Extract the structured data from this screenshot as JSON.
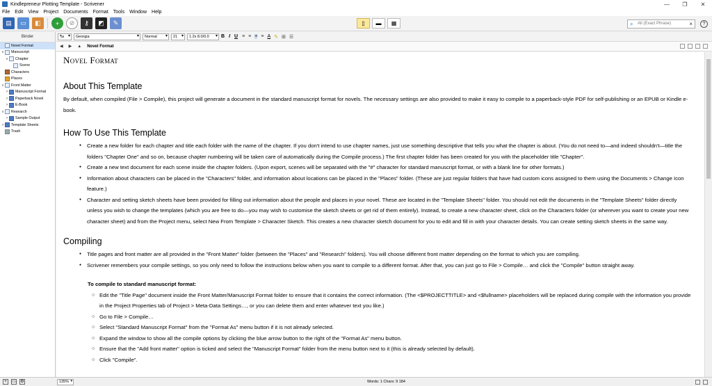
{
  "window": {
    "title": "Kindlepreneur Plotting Template - Scrivener",
    "minimize": "—",
    "restore": "❐",
    "close": "✕"
  },
  "menu": [
    "File",
    "Edit",
    "View",
    "Project",
    "Documents",
    "Format",
    "Tools",
    "Window",
    "Help"
  ],
  "search": {
    "placeholder": "All (Exact Phrase)"
  },
  "binder": {
    "header": "Binder",
    "items": [
      {
        "label": "Novel Format",
        "indent": 0,
        "arrow": "",
        "icon": "doc",
        "selected": true
      },
      {
        "label": "Manuscript",
        "indent": 0,
        "arrow": "∨",
        "icon": "doc"
      },
      {
        "label": "Chapter",
        "indent": 1,
        "arrow": "∨",
        "icon": "doc"
      },
      {
        "label": "Scene",
        "indent": 2,
        "arrow": "",
        "icon": "doc"
      },
      {
        "label": "Characters",
        "indent": 0,
        "arrow": "",
        "icon": "chars"
      },
      {
        "label": "Places",
        "indent": 0,
        "arrow": "",
        "icon": "places"
      },
      {
        "label": "Front Matter",
        "indent": 0,
        "arrow": "∨",
        "icon": "doc"
      },
      {
        "label": "Manuscript Format",
        "indent": 1,
        "arrow": ">",
        "icon": "folder"
      },
      {
        "label": "Paperback Novel",
        "indent": 1,
        "arrow": ">",
        "icon": "folder"
      },
      {
        "label": "E-Book",
        "indent": 1,
        "arrow": ">",
        "icon": "folder"
      },
      {
        "label": "Research",
        "indent": 0,
        "arrow": "∨",
        "icon": "doc"
      },
      {
        "label": "Sample Output",
        "indent": 1,
        "arrow": ">",
        "icon": "folder"
      },
      {
        "label": "Template Sheets",
        "indent": 0,
        "arrow": ">",
        "icon": "folder"
      },
      {
        "label": "Trash",
        "indent": 0,
        "arrow": "",
        "icon": "trash"
      }
    ]
  },
  "format": {
    "style": "¶a",
    "font": "Georgia",
    "weight": "Normal",
    "size": "21",
    "spacing": "1.2x 8.0/0.0",
    "bold": "B",
    "italic": "I",
    "underline": "U"
  },
  "header": {
    "back": "◀",
    "forward": "▶",
    "doc_title": "Novel Format"
  },
  "doc": {
    "heading": "Novel Format",
    "about_title": "About This Template",
    "about_body": "By default, when compiled (File > Compile), this project will generate a document in the standard manuscript format for novels. The necessary settings are also provided to make it easy to compile to a paperback-style PDF for self-publishing or an EPUB or Kindle e-book.",
    "howto_title": "How To Use This Template",
    "howto_items": [
      "Create a new folder for each chapter and title each folder with the name of the chapter. If you don't intend to use chapter names, just use something descriptive that tells you what the chapter is about. (You do not need to—and indeed shouldn't—title the folders \"Chapter One\" and so on, because chapter numbering will be taken care of automatically during the Compile process.) The first chapter folder has been created for you with the placeholder title \"Chapter\".",
      "Create a new text document for each scene inside the chapter folders. (Upon export, scenes will be separated with the \"#\" character for standard manuscript format, or with a blank line for other formats.)",
      "Information about characters can be placed in the \"Characters\" folder, and information about locations can be placed in the \"Places\" folder. (These are just regular folders that have had custom icons assigned to them using the Documents > Change Icon feature.)",
      "Character and setting sketch sheets have been provided for filling out information about the people and places in your novel. These are located in the \"Template Sheets\" folder. You should not edit the documents in the \"Template Sheets\" folder directly unless you wish to change the templates (which you are free to do—you may wish to customise the sketch sheets or get rid of them entirely). Instead, to create a new character sheet, click on the Characters folder (or wherever you want to create your new character sheet) and from the Project menu, select New From Template > Character Sketch. This creates a new character sketch document for you to edit and fill in with your character details. You can create setting sketch sheets in the same way."
    ],
    "compiling_title": "Compiling",
    "compiling_items": [
      "Title pages and front matter are all provided in the \"Front Matter\" folder (between the \"Places\" and \"Research\" folders). You will choose different front matter depending on the format to which you are compiling.",
      "Scrivener remembers your compile settings, so you only need to follow the instructions below when you want to compile to a different format. After that, you can just go to File > Compile… and click the \"Compile\" button straight away."
    ],
    "compile_sub": "To compile to standard manuscript format:",
    "compile_steps": [
      "Edit the \"Title Page\" document inside the Front Matter/Manuscript Format folder to ensure that it contains the correct information. (The <$PROJECTTITLE> and <$fullname> placeholders will be replaced during compile with the information you provide in the Project Properties tab of Project > Meta-Data Settings…, or you can delete them and enter whatever text you like.)",
      "Go to File > Compile…",
      "Select \"Standard Manuscript Format\" from the \"Format As\" menu button if it is not already selected.",
      "Expand the window to show all the compile options by clicking the blue arrow button to the right of the \"Format As\" menu button.",
      "Ensure that the \"Add front matter\" option is ticked and select the \"Manuscript Format\" folder from the menu button next to it (this is already selected by default).",
      "Click \"Compile\"."
    ]
  },
  "status": {
    "zoom": "135%",
    "words": "Words: 1   Chars: 9 184"
  },
  "colors": {
    "accent_green": "#2e9e3a",
    "selection": "#cde1f8",
    "active_view": "#fbe89a"
  }
}
